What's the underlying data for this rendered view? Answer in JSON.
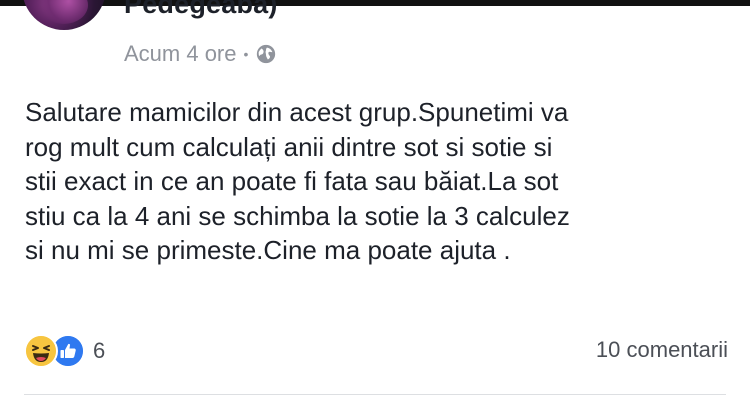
{
  "post": {
    "author_name": "Pedegeaba)",
    "timestamp": "Acum 4 ore",
    "separator": "•",
    "privacy_icon": "globe-icon",
    "text_lines": [
      "Salutare mamicilor din acest grup.Spunetimi va",
      "rog mult cum calculați anii dintre sot si sotie si",
      "stii exact in ce an poate fi fata sau băiat.La sot",
      "stiu ca la 4 ani se schimba la sotie la 3 calculez",
      "si nu mi se primeste.Cine ma poate ajuta ."
    ]
  },
  "footer": {
    "reaction_icons": [
      "haha-reaction-icon",
      "like-reaction-icon"
    ],
    "reaction_count": "6",
    "comments_label": "10 comentarii"
  },
  "colors": {
    "text": "#1d2129",
    "meta": "#90949c",
    "like_blue": "#2f79f0",
    "haha_yellow": "#f7c540",
    "divider": "#dddfe2"
  }
}
